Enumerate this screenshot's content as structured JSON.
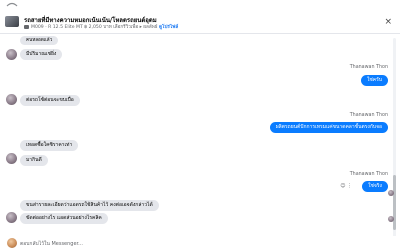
{
  "header": {
    "title": "รถสายที่มีทางความหมอกเน้นเน้น/โหลดรถยนต์อุดม",
    "meta_prefix": "M009 · R 12.5 Elite MT",
    "meta_price": "฿ 2,050 บาท",
    "meta_extra": "เลือกรีวิวเพื่อ ▸ ผลลัพธ์",
    "link": "ดูโปรไฟล์",
    "close_glyph": "×"
  },
  "messages": {
    "in_top_partial": "คนหลอดแล้ว",
    "in_1": "มีปริมาณเช่ยิ่ง",
    "sender_1": "Thanawan Thon",
    "out_1": "ใช่ครับ",
    "in_2": "ต่อรถโซ้ต่อนจะขบเบื่อ",
    "sender_2": "Thanawan Thon",
    "out_2": "ผลิตรถยนต์ปักการเทรมแค่ขนาดคลาชั้นตรงกับจอ",
    "in_3": "เทอดซื้อใคซิราคาเท่า",
    "in_4": "มากินดี",
    "sender_3": "Thanawan Thon",
    "out_3": "ใช่จริง",
    "in_5": "ขนส่ารายละเอียดว่าแอดรถใช้สินค้าไว้ คงต่อเอจดังกล่าวได้",
    "in_6": "ขัดต่ออย่างไร แอดส่วนอย่างไรคลิค"
  },
  "composer": {
    "placeholder": "ตอบกลับไว้ใน Messenger..."
  },
  "colors": {
    "outgoing_bubble": "#0a7cff",
    "incoming_bubble": "#e4e6eb",
    "link": "#1877f2"
  }
}
